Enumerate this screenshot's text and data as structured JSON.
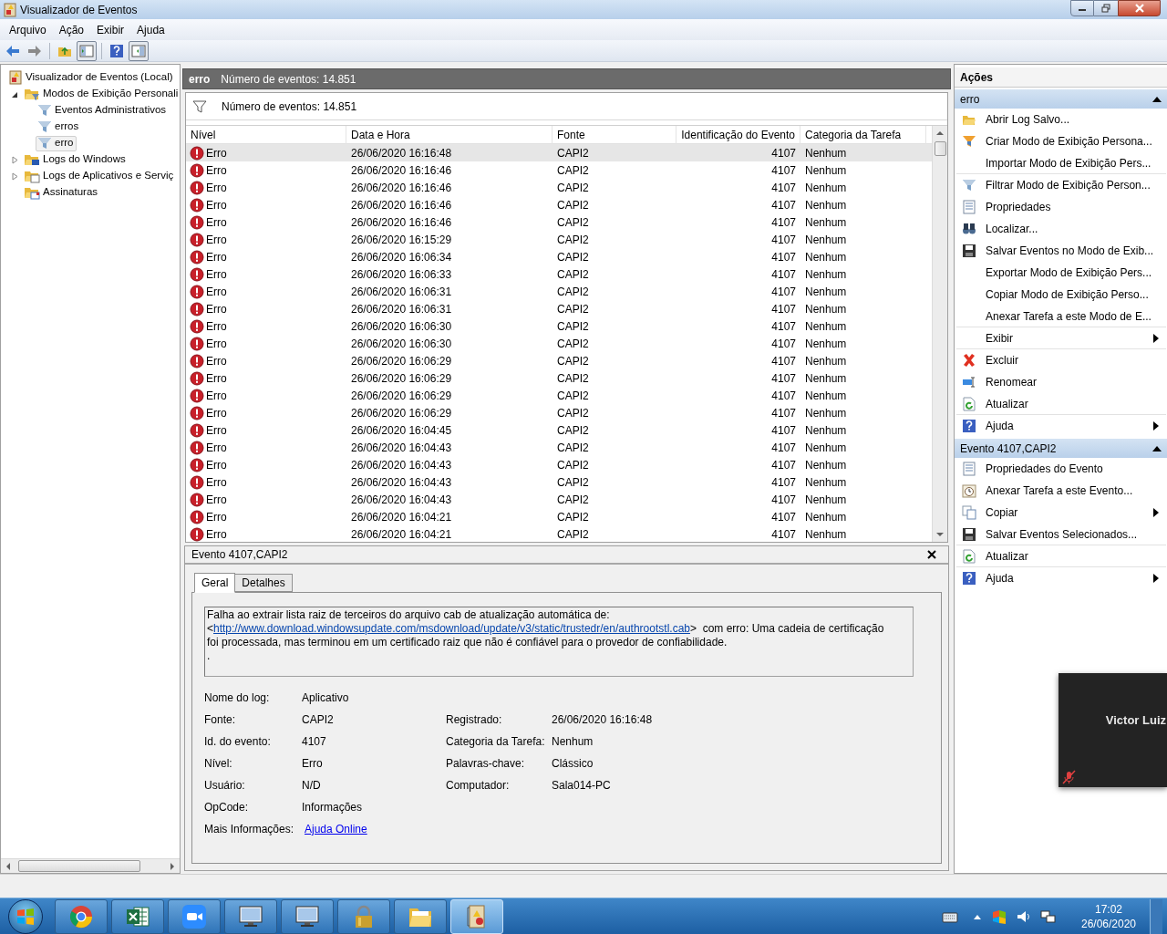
{
  "window": {
    "title": "Visualizador de Eventos"
  },
  "menu": [
    "Arquivo",
    "Ação",
    "Exibir",
    "Ajuda"
  ],
  "toolbar": [
    {
      "kind": "back",
      "pressed": false
    },
    {
      "kind": "forward",
      "pressed": false
    },
    {
      "kind": "up",
      "pressed": false
    },
    {
      "kind": "tree",
      "pressed": true
    },
    {
      "kind": "help",
      "pressed": false
    },
    {
      "kind": "pane",
      "pressed": true
    }
  ],
  "tree": [
    {
      "label": "Visualizador de Eventos (Local)",
      "kind": "root",
      "selected": false,
      "children": [
        {
          "label": "Modos de Exibição Personali",
          "kind": "views",
          "selected": false,
          "expanded": true,
          "children": [
            {
              "label": "Eventos Administrativos",
              "kind": "filter",
              "selected": false
            },
            {
              "label": "erros",
              "kind": "filter",
              "selected": false
            },
            {
              "label": "erro",
              "kind": "filter",
              "selected": true
            }
          ]
        },
        {
          "label": "Logs do Windows",
          "kind": "winlogs",
          "selected": false,
          "expanded": false
        },
        {
          "label": "Logs de Aplicativos e Serviç",
          "kind": "applogs",
          "selected": false,
          "expanded": false
        },
        {
          "label": "Assinaturas",
          "kind": "subs",
          "selected": false
        }
      ]
    }
  ],
  "event_list": {
    "title": "erro",
    "count": "Número de eventos: 14.851",
    "filter_text": "Número de eventos: 14.851",
    "columns": [
      "Nível",
      "Data e Hora",
      "Fonte",
      "Identificação do Evento",
      "Categoria da Tarefa"
    ],
    "rows": [
      {
        "cells": [
          "Erro",
          "26/06/2020 16:16:48",
          "CAPI2",
          "4107",
          "Nenhum"
        ],
        "selected": true
      },
      {
        "cells": [
          "Erro",
          "26/06/2020 16:16:46",
          "CAPI2",
          "4107",
          "Nenhum"
        ],
        "selected": false
      },
      {
        "cells": [
          "Erro",
          "26/06/2020 16:16:46",
          "CAPI2",
          "4107",
          "Nenhum"
        ],
        "selected": false
      },
      {
        "cells": [
          "Erro",
          "26/06/2020 16:16:46",
          "CAPI2",
          "4107",
          "Nenhum"
        ],
        "selected": false
      },
      {
        "cells": [
          "Erro",
          "26/06/2020 16:16:46",
          "CAPI2",
          "4107",
          "Nenhum"
        ],
        "selected": false
      },
      {
        "cells": [
          "Erro",
          "26/06/2020 16:15:29",
          "CAPI2",
          "4107",
          "Nenhum"
        ],
        "selected": false
      },
      {
        "cells": [
          "Erro",
          "26/06/2020 16:06:34",
          "CAPI2",
          "4107",
          "Nenhum"
        ],
        "selected": false
      },
      {
        "cells": [
          "Erro",
          "26/06/2020 16:06:33",
          "CAPI2",
          "4107",
          "Nenhum"
        ],
        "selected": false
      },
      {
        "cells": [
          "Erro",
          "26/06/2020 16:06:31",
          "CAPI2",
          "4107",
          "Nenhum"
        ],
        "selected": false
      },
      {
        "cells": [
          "Erro",
          "26/06/2020 16:06:31",
          "CAPI2",
          "4107",
          "Nenhum"
        ],
        "selected": false
      },
      {
        "cells": [
          "Erro",
          "26/06/2020 16:06:30",
          "CAPI2",
          "4107",
          "Nenhum"
        ],
        "selected": false
      },
      {
        "cells": [
          "Erro",
          "26/06/2020 16:06:30",
          "CAPI2",
          "4107",
          "Nenhum"
        ],
        "selected": false
      },
      {
        "cells": [
          "Erro",
          "26/06/2020 16:06:29",
          "CAPI2",
          "4107",
          "Nenhum"
        ],
        "selected": false
      },
      {
        "cells": [
          "Erro",
          "26/06/2020 16:06:29",
          "CAPI2",
          "4107",
          "Nenhum"
        ],
        "selected": false
      },
      {
        "cells": [
          "Erro",
          "26/06/2020 16:06:29",
          "CAPI2",
          "4107",
          "Nenhum"
        ],
        "selected": false
      },
      {
        "cells": [
          "Erro",
          "26/06/2020 16:06:29",
          "CAPI2",
          "4107",
          "Nenhum"
        ],
        "selected": false
      },
      {
        "cells": [
          "Erro",
          "26/06/2020 16:04:45",
          "CAPI2",
          "4107",
          "Nenhum"
        ],
        "selected": false
      },
      {
        "cells": [
          "Erro",
          "26/06/2020 16:04:43",
          "CAPI2",
          "4107",
          "Nenhum"
        ],
        "selected": false
      },
      {
        "cells": [
          "Erro",
          "26/06/2020 16:04:43",
          "CAPI2",
          "4107",
          "Nenhum"
        ],
        "selected": false
      },
      {
        "cells": [
          "Erro",
          "26/06/2020 16:04:43",
          "CAPI2",
          "4107",
          "Nenhum"
        ],
        "selected": false
      },
      {
        "cells": [
          "Erro",
          "26/06/2020 16:04:43",
          "CAPI2",
          "4107",
          "Nenhum"
        ],
        "selected": false
      },
      {
        "cells": [
          "Erro",
          "26/06/2020 16:04:21",
          "CAPI2",
          "4107",
          "Nenhum"
        ],
        "selected": false
      },
      {
        "cells": [
          "Erro",
          "26/06/2020 16:04:21",
          "CAPI2",
          "4107",
          "Nenhum"
        ],
        "selected": false
      }
    ]
  },
  "details": {
    "title": "Evento 4107,CAPI2",
    "tabs": [
      {
        "label": "Geral",
        "selected": true
      },
      {
        "label": "Detalhes",
        "selected": false
      }
    ],
    "message_before": "Falha ao extrair lista raiz de terceiros do arquivo cab de atualização automática de:\n<",
    "message_link": "http://www.download.windowsupdate.com/msdownload/update/v3/static/trustedr/en/authrootstl.cab",
    "message_after": ">  com erro: Uma cadeia de certificação\nfoi processada, mas terminou em um certificado raiz que não é confiável para o provedor de confiabilidade.\n.",
    "left_fields": [
      {
        "label": "Nome do log:",
        "value": "Aplicativo",
        "link": false
      },
      {
        "label": "Fonte:",
        "value": "CAPI2",
        "link": false
      },
      {
        "label": "Id. do evento:",
        "value": "4107",
        "link": false
      },
      {
        "label": "Nível:",
        "value": "Erro",
        "link": false
      },
      {
        "label": "Usuário:",
        "value": "N/D",
        "link": false
      },
      {
        "label": "OpCode:",
        "value": "Informações",
        "link": false
      },
      {
        "label": "Mais Informações:",
        "value": "Ajuda Online",
        "link": true
      }
    ],
    "right_fields": [
      {
        "label": "Registrado:",
        "value": "26/06/2020 16:16:48"
      },
      {
        "label": "Categoria da Tarefa:",
        "value": "Nenhum"
      },
      {
        "label": "Palavras-chave:",
        "value": "Clássico"
      },
      {
        "label": "Computador:",
        "value": "Sala014-PC"
      }
    ]
  },
  "actions": {
    "title": "Ações",
    "sections": [
      {
        "title": "erro",
        "expanded": true,
        "items": [
          {
            "label": "Abrir Log Salvo...",
            "kind": "open",
            "submenu": false,
            "divider": false
          },
          {
            "label": "Criar Modo de Exibição Persona...",
            "kind": "newfilter",
            "submenu": false,
            "divider": false
          },
          {
            "label": "Importar Modo de Exibição Pers...",
            "kind": "none",
            "submenu": false,
            "divider": true
          },
          {
            "label": "Filtrar Modo de Exibição Person...",
            "kind": "filter",
            "submenu": false,
            "divider": false
          },
          {
            "label": "Propriedades",
            "kind": "props",
            "submenu": false,
            "divider": false
          },
          {
            "label": "Localizar...",
            "kind": "find",
            "submenu": false,
            "divider": false
          },
          {
            "label": "Salvar Eventos no Modo de Exib...",
            "kind": "save",
            "submenu": false,
            "divider": false
          },
          {
            "label": "Exportar Modo de Exibição Pers...",
            "kind": "none",
            "submenu": false,
            "divider": false
          },
          {
            "label": "Copiar Modo de Exibição Perso...",
            "kind": "none",
            "submenu": false,
            "divider": false
          },
          {
            "label": "Anexar Tarefa a este Modo de E...",
            "kind": "none",
            "submenu": false,
            "divider": true
          },
          {
            "label": "Exibir",
            "kind": "none",
            "submenu": true,
            "divider": true
          },
          {
            "label": "Excluir",
            "kind": "delete",
            "submenu": false,
            "divider": false
          },
          {
            "label": "Renomear",
            "kind": "rename",
            "submenu": false,
            "divider": false
          },
          {
            "label": "Atualizar",
            "kind": "refresh",
            "submenu": false,
            "divider": true
          },
          {
            "label": "Ajuda",
            "kind": "help",
            "submenu": true,
            "divider": false
          }
        ]
      },
      {
        "title": "Evento 4107,CAPI2",
        "expanded": true,
        "items": [
          {
            "label": "Propriedades do Evento",
            "kind": "props",
            "submenu": false,
            "divider": false
          },
          {
            "label": "Anexar Tarefa a este Evento...",
            "kind": "task",
            "submenu": false,
            "divider": false
          },
          {
            "label": "Copiar",
            "kind": "copy",
            "submenu": true,
            "divider": false
          },
          {
            "label": "Salvar Eventos Selecionados...",
            "kind": "save",
            "submenu": false,
            "divider": true
          },
          {
            "label": "Atualizar",
            "kind": "refresh",
            "submenu": false,
            "divider": true
          },
          {
            "label": "Ajuda",
            "kind": "help",
            "submenu": true,
            "divider": false
          }
        ]
      }
    ]
  },
  "video_tile": {
    "name": "Victor Luiz",
    "muted": true
  },
  "taskbar": {
    "apps": [
      {
        "kind": "browser",
        "active": false
      },
      {
        "kind": "sheet",
        "active": false
      },
      {
        "kind": "camera",
        "active": false
      },
      {
        "kind": "monitor",
        "active": false
      },
      {
        "kind": "monitor",
        "active": false
      },
      {
        "kind": "lock",
        "active": false
      },
      {
        "kind": "folder",
        "active": false
      },
      {
        "kind": "eventlog",
        "active": true
      }
    ],
    "time": "17:02",
    "date": "26/06/2020"
  }
}
